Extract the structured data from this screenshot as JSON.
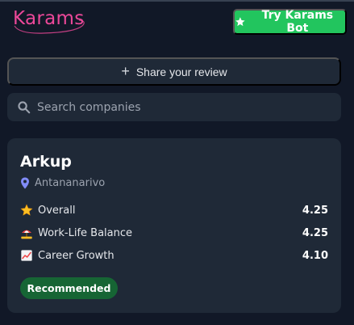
{
  "header": {
    "logo_text": "Karams",
    "bot_button_label": "Try Karams Bot"
  },
  "actions": {
    "share_review_label": "Share your review"
  },
  "search": {
    "placeholder": "Search companies",
    "value": ""
  },
  "company_card": {
    "name": "Arkup",
    "location": "Antananarivo",
    "metrics": [
      {
        "icon": "star-icon",
        "label": "Overall",
        "value": "4.25"
      },
      {
        "icon": "beach-umbrella-icon",
        "label": "Work-Life Balance",
        "value": "4.25"
      },
      {
        "icon": "chart-increasing-icon",
        "label": "Career Growth",
        "value": "4.10"
      }
    ],
    "badge": "Recommended"
  },
  "colors": {
    "background": "#111827",
    "surface": "#1f2937",
    "brand_pink": "#ec4899",
    "bot_green": "#22c55e",
    "badge_green": "#166534"
  }
}
